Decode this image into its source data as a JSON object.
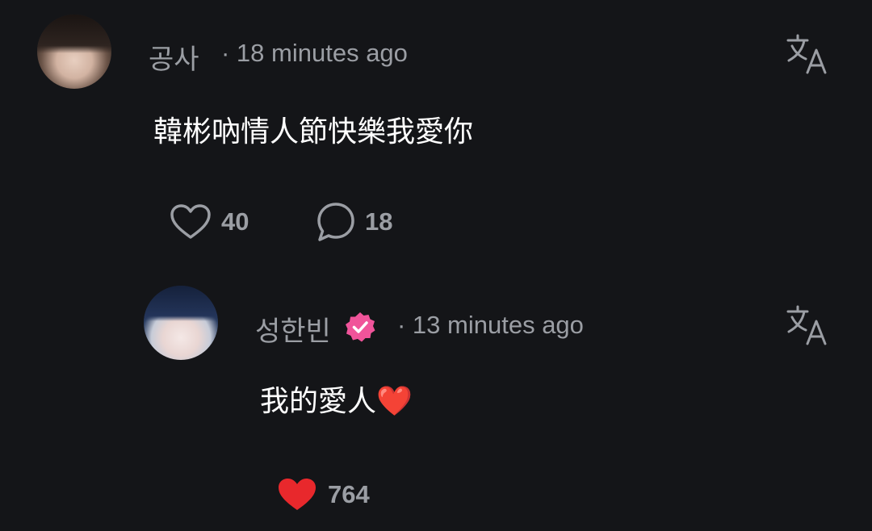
{
  "comments": [
    {
      "username": "공사",
      "timestamp": "· 18 minutes ago",
      "text": "韓彬吶情人節快樂我愛你",
      "likes": "40",
      "replies": "18"
    },
    {
      "username": "성한빈",
      "timestamp": "· 13 minutes ago",
      "text": "我的愛人❤️",
      "likes": "764",
      "verified": true,
      "liked": true
    }
  ],
  "colors": {
    "background": "#141518",
    "muted_text": "#9b9ea4",
    "liked_heart": "#e8282c",
    "verified_badge": "#f0549a"
  },
  "icons": [
    "translate-icon",
    "heart-outline-icon",
    "comment-icon",
    "heart-filled-icon",
    "verified-badge-icon"
  ]
}
